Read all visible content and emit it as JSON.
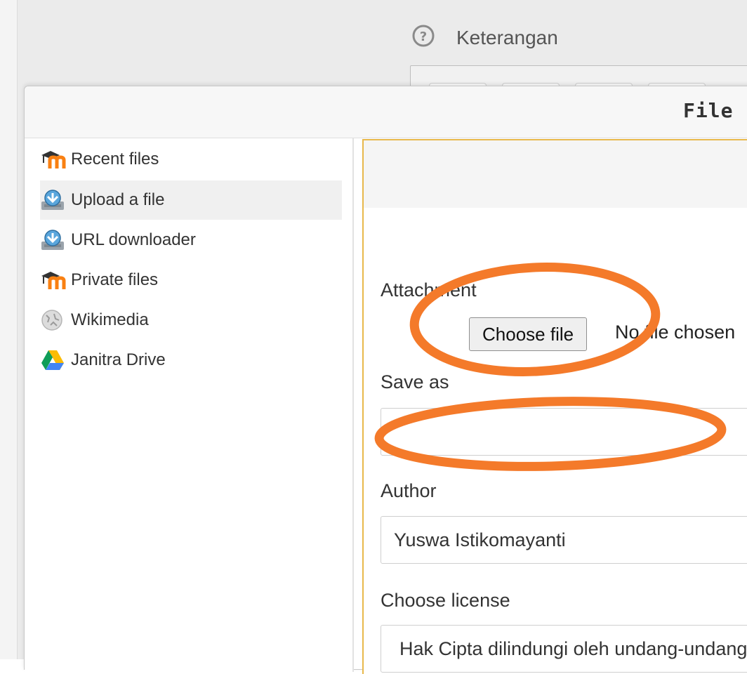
{
  "background": {
    "help_label": "Keterangan"
  },
  "dialog": {
    "title": "File"
  },
  "repositories": [
    {
      "label": "Recent files",
      "icon": "moodle-icon",
      "active": false
    },
    {
      "label": "Upload a file",
      "icon": "upload-icon",
      "active": true
    },
    {
      "label": "URL downloader",
      "icon": "url-download-icon",
      "active": false
    },
    {
      "label": "Private files",
      "icon": "moodle-icon",
      "active": false
    },
    {
      "label": "Wikimedia",
      "icon": "wikimedia-icon",
      "active": false
    },
    {
      "label": "Janitra Drive",
      "icon": "google-drive-icon",
      "active": false
    }
  ],
  "upload_form": {
    "attachment_label": "Attachment",
    "choose_file_label": "Choose file",
    "no_file_text": "No file chosen",
    "save_as_label": "Save as",
    "save_as_value": "",
    "author_label": "Author",
    "author_value": "Yuswa Istikomayanti",
    "license_label": "Choose license",
    "license_value": "Hak Cipta dilindungi oleh undang-undang"
  },
  "colors": {
    "annotation": "#f47a2a",
    "panel_border": "#e8b84b",
    "moodle_orange": "#f98012"
  }
}
